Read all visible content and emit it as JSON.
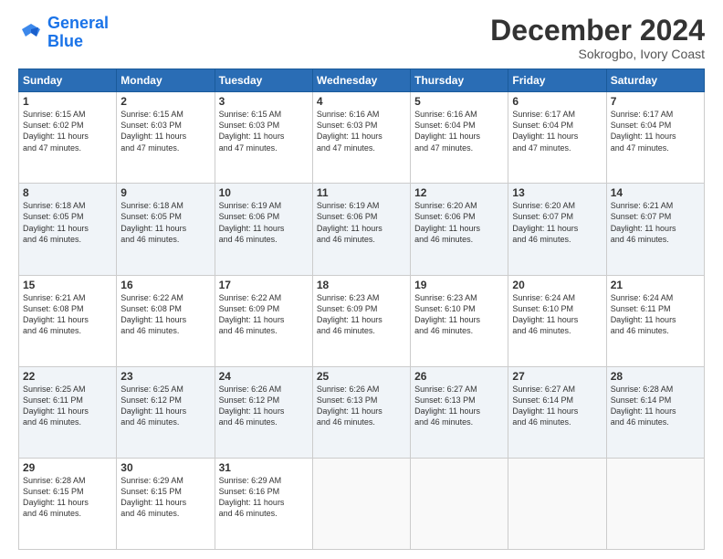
{
  "logo": {
    "line1": "General",
    "line2": "Blue"
  },
  "title": "December 2024",
  "subtitle": "Sokrogbo, Ivory Coast",
  "days_header": [
    "Sunday",
    "Monday",
    "Tuesday",
    "Wednesday",
    "Thursday",
    "Friday",
    "Saturday"
  ],
  "weeks": [
    [
      {
        "num": "1",
        "sunrise": "6:15 AM",
        "sunset": "6:02 PM",
        "daylight": "11 hours and 47 minutes."
      },
      {
        "num": "2",
        "sunrise": "6:15 AM",
        "sunset": "6:03 PM",
        "daylight": "11 hours and 47 minutes."
      },
      {
        "num": "3",
        "sunrise": "6:15 AM",
        "sunset": "6:03 PM",
        "daylight": "11 hours and 47 minutes."
      },
      {
        "num": "4",
        "sunrise": "6:16 AM",
        "sunset": "6:03 PM",
        "daylight": "11 hours and 47 minutes."
      },
      {
        "num": "5",
        "sunrise": "6:16 AM",
        "sunset": "6:04 PM",
        "daylight": "11 hours and 47 minutes."
      },
      {
        "num": "6",
        "sunrise": "6:17 AM",
        "sunset": "6:04 PM",
        "daylight": "11 hours and 47 minutes."
      },
      {
        "num": "7",
        "sunrise": "6:17 AM",
        "sunset": "6:04 PM",
        "daylight": "11 hours and 47 minutes."
      }
    ],
    [
      {
        "num": "8",
        "sunrise": "6:18 AM",
        "sunset": "6:05 PM",
        "daylight": "11 hours and 46 minutes."
      },
      {
        "num": "9",
        "sunrise": "6:18 AM",
        "sunset": "6:05 PM",
        "daylight": "11 hours and 46 minutes."
      },
      {
        "num": "10",
        "sunrise": "6:19 AM",
        "sunset": "6:06 PM",
        "daylight": "11 hours and 46 minutes."
      },
      {
        "num": "11",
        "sunrise": "6:19 AM",
        "sunset": "6:06 PM",
        "daylight": "11 hours and 46 minutes."
      },
      {
        "num": "12",
        "sunrise": "6:20 AM",
        "sunset": "6:06 PM",
        "daylight": "11 hours and 46 minutes."
      },
      {
        "num": "13",
        "sunrise": "6:20 AM",
        "sunset": "6:07 PM",
        "daylight": "11 hours and 46 minutes."
      },
      {
        "num": "14",
        "sunrise": "6:21 AM",
        "sunset": "6:07 PM",
        "daylight": "11 hours and 46 minutes."
      }
    ],
    [
      {
        "num": "15",
        "sunrise": "6:21 AM",
        "sunset": "6:08 PM",
        "daylight": "11 hours and 46 minutes."
      },
      {
        "num": "16",
        "sunrise": "6:22 AM",
        "sunset": "6:08 PM",
        "daylight": "11 hours and 46 minutes."
      },
      {
        "num": "17",
        "sunrise": "6:22 AM",
        "sunset": "6:09 PM",
        "daylight": "11 hours and 46 minutes."
      },
      {
        "num": "18",
        "sunrise": "6:23 AM",
        "sunset": "6:09 PM",
        "daylight": "11 hours and 46 minutes."
      },
      {
        "num": "19",
        "sunrise": "6:23 AM",
        "sunset": "6:10 PM",
        "daylight": "11 hours and 46 minutes."
      },
      {
        "num": "20",
        "sunrise": "6:24 AM",
        "sunset": "6:10 PM",
        "daylight": "11 hours and 46 minutes."
      },
      {
        "num": "21",
        "sunrise": "6:24 AM",
        "sunset": "6:11 PM",
        "daylight": "11 hours and 46 minutes."
      }
    ],
    [
      {
        "num": "22",
        "sunrise": "6:25 AM",
        "sunset": "6:11 PM",
        "daylight": "11 hours and 46 minutes."
      },
      {
        "num": "23",
        "sunrise": "6:25 AM",
        "sunset": "6:12 PM",
        "daylight": "11 hours and 46 minutes."
      },
      {
        "num": "24",
        "sunrise": "6:26 AM",
        "sunset": "6:12 PM",
        "daylight": "11 hours and 46 minutes."
      },
      {
        "num": "25",
        "sunrise": "6:26 AM",
        "sunset": "6:13 PM",
        "daylight": "11 hours and 46 minutes."
      },
      {
        "num": "26",
        "sunrise": "6:27 AM",
        "sunset": "6:13 PM",
        "daylight": "11 hours and 46 minutes."
      },
      {
        "num": "27",
        "sunrise": "6:27 AM",
        "sunset": "6:14 PM",
        "daylight": "11 hours and 46 minutes."
      },
      {
        "num": "28",
        "sunrise": "6:28 AM",
        "sunset": "6:14 PM",
        "daylight": "11 hours and 46 minutes."
      }
    ],
    [
      {
        "num": "29",
        "sunrise": "6:28 AM",
        "sunset": "6:15 PM",
        "daylight": "11 hours and 46 minutes."
      },
      {
        "num": "30",
        "sunrise": "6:29 AM",
        "sunset": "6:15 PM",
        "daylight": "11 hours and 46 minutes."
      },
      {
        "num": "31",
        "sunrise": "6:29 AM",
        "sunset": "6:16 PM",
        "daylight": "11 hours and 46 minutes."
      },
      null,
      null,
      null,
      null
    ]
  ]
}
